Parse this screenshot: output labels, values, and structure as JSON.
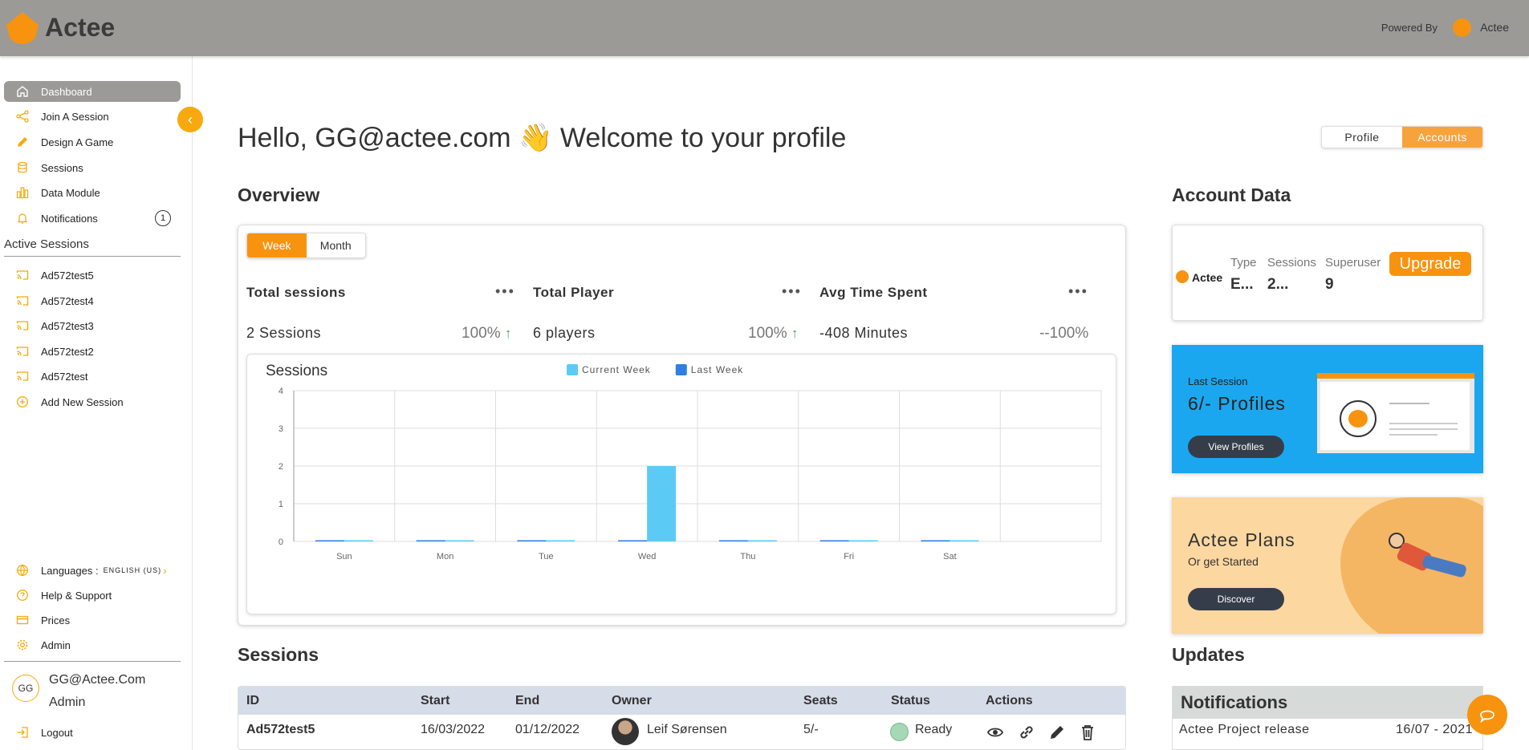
{
  "app": {
    "name": "Actee",
    "powered_by_label": "Powered By",
    "powered_by_name": "Actee"
  },
  "sidebar": {
    "nav": [
      {
        "label": "Dashboard",
        "icon": "home-icon"
      },
      {
        "label": "Join A Session",
        "icon": "share-icon"
      },
      {
        "label": "Design A Game",
        "icon": "pencil-icon"
      },
      {
        "label": "Sessions",
        "icon": "database-icon"
      },
      {
        "label": "Data Module",
        "icon": "bar-chart-icon"
      },
      {
        "label": "Notifications",
        "icon": "bell-icon",
        "badge": "1"
      }
    ],
    "active_sessions_title": "Active Sessions",
    "active_sessions": [
      "Ad572test5",
      "Ad572test4",
      "Ad572test3",
      "Ad572test2",
      "Ad572test"
    ],
    "add_session_label": "Add New Session",
    "bottom": {
      "languages_label": "Languages :",
      "languages_value": "ENGLISH (US)",
      "help_label": "Help & Support",
      "prices_label": "Prices",
      "admin_label": "Admin"
    },
    "user": {
      "initials": "GG",
      "name": "GG@Actee.Com",
      "role": "Admin"
    },
    "logout_label": "Logout"
  },
  "header": {
    "greeting": "Hello, GG@actee.com 👋 Welcome to your profile",
    "toggle": {
      "profile": "Profile",
      "accounts": "Accounts"
    }
  },
  "overview": {
    "title": "Overview",
    "range": {
      "week": "Week",
      "month": "Month"
    },
    "stats": [
      {
        "title": "Total sessions",
        "value": "2 Sessions",
        "pct": "100%",
        "trend": "up"
      },
      {
        "title": "Total Player",
        "value": "6 players",
        "pct": "100%",
        "trend": "up"
      },
      {
        "title": "Avg Time Spent",
        "value": "-408 Minutes",
        "pct": "--100%",
        "trend": ""
      }
    ],
    "more_dots": "•••"
  },
  "chart_data": {
    "type": "bar",
    "title": "Sessions",
    "categories": [
      "Sun",
      "Mon",
      "Tue",
      "Wed",
      "Thu",
      "Fri",
      "Sat"
    ],
    "series": [
      {
        "name": "Current Week",
        "values": [
          0,
          0,
          0,
          2,
          0,
          0,
          0
        ],
        "color": "#5bcbf5"
      },
      {
        "name": "Last Week",
        "values": [
          0,
          0,
          0,
          0,
          0,
          0,
          0
        ],
        "color": "#2f7fe0"
      }
    ],
    "ylim": [
      0,
      4
    ],
    "yticks": [
      "0",
      "1",
      "2",
      "3",
      "4"
    ],
    "grid": true,
    "legend": "top-center"
  },
  "sessions": {
    "title": "Sessions",
    "columns": [
      "ID",
      "Start",
      "End",
      "Owner",
      "Seats",
      "Status",
      "Actions"
    ],
    "rows": [
      {
        "id": "Ad572test5",
        "start": "16/03/2022",
        "end": "01/12/2022",
        "owner": "Leif Sørensen",
        "seats": "5/-",
        "status": "Ready"
      }
    ]
  },
  "account": {
    "title": "Account Data",
    "brand": "Actee",
    "type_label": "Type",
    "type_value": "E...",
    "sessions_label": "Sessions",
    "sessions_value": "2...",
    "superuser_label": "Superuser",
    "superuser_value": "9",
    "upgrade_label": "Upgrade"
  },
  "last_session": {
    "label": "Last Session",
    "value": "6/- Profiles",
    "button": "View Profiles"
  },
  "plans": {
    "title": "Actee Plans",
    "subtitle": "Or get Started",
    "button": "Discover"
  },
  "updates": {
    "title": "Updates",
    "notifications_title": "Notifications",
    "items": [
      {
        "text": "Actee Project release",
        "date": "16/07 - 2021"
      }
    ]
  },
  "colors": {
    "brand": "#f7930f",
    "sidebar_active": "#9b9a97",
    "blue_card": "#1ba7ef",
    "plans_card": "#fcd7a0"
  }
}
